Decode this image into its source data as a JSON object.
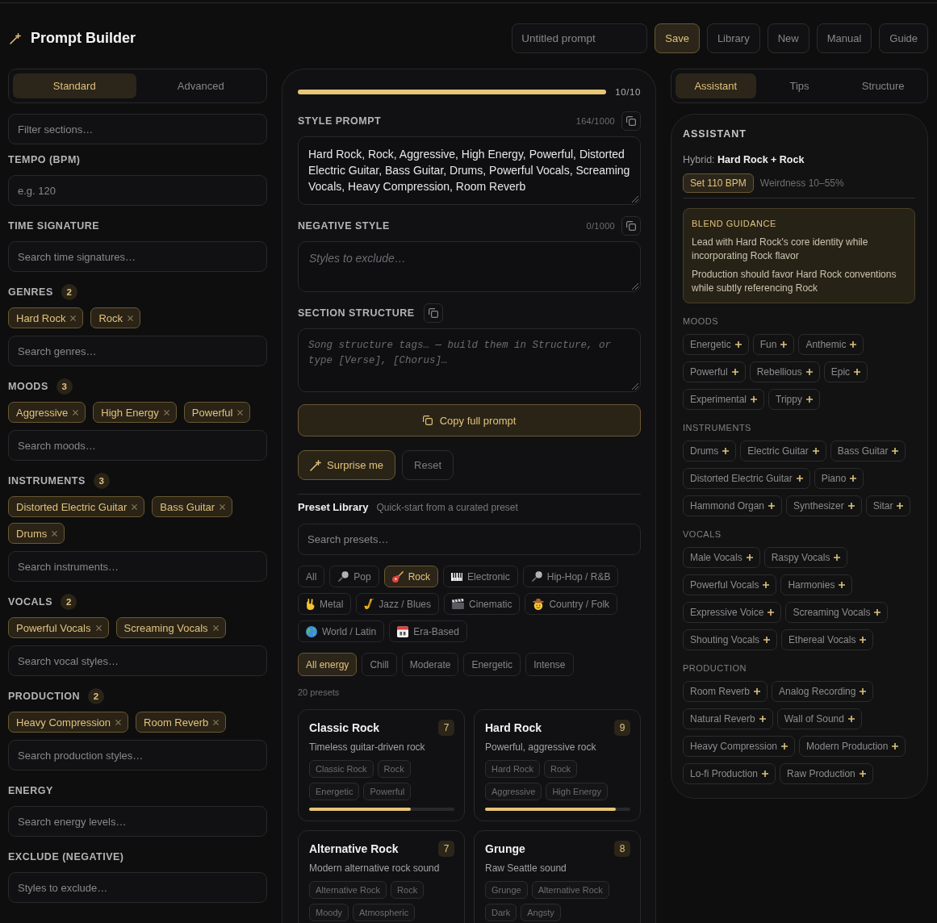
{
  "header": {
    "title": "Prompt Builder",
    "name_field": {
      "placeholder": "Untitled prompt"
    },
    "buttons": [
      {
        "label": "Save",
        "kind": "primary"
      },
      {
        "label": "Library",
        "kind": "plain"
      },
      {
        "label": "New",
        "kind": "plain"
      },
      {
        "label": "Manual",
        "kind": "plain"
      },
      {
        "label": "Guide",
        "kind": "plain"
      }
    ]
  },
  "sidebar": {
    "mode_tabs": [
      {
        "label": "Standard",
        "selected": true
      },
      {
        "label": "Advanced",
        "selected": false
      }
    ],
    "filter": {
      "placeholder": "Filter sections…"
    },
    "sections": [
      {
        "title": "TEMPO (BPM)",
        "field": {
          "placeholder": "e.g. 120"
        }
      },
      {
        "title": "TIME SIGNATURE",
        "field": {
          "placeholder": "Search time signatures…"
        }
      },
      {
        "title": "GENRES",
        "count": "2",
        "chips": [
          "Hard Rock",
          "Rock"
        ],
        "field": {
          "placeholder": "Search genres…"
        }
      },
      {
        "title": "MOODS",
        "count": "3",
        "chips": [
          "Aggressive",
          "High Energy",
          "Powerful"
        ],
        "field": {
          "placeholder": "Search moods…"
        }
      },
      {
        "title": "INSTRUMENTS",
        "count": "3",
        "chips": [
          "Distorted Electric Guitar",
          "Bass Guitar",
          "Drums"
        ],
        "field": {
          "placeholder": "Search instruments…"
        }
      },
      {
        "title": "VOCALS",
        "count": "2",
        "chips": [
          "Powerful Vocals",
          "Screaming Vocals"
        ],
        "field": {
          "placeholder": "Search vocal styles…"
        }
      },
      {
        "title": "PRODUCTION",
        "count": "2",
        "chips": [
          "Heavy Compression",
          "Room Reverb"
        ],
        "field": {
          "placeholder": "Search production styles…"
        }
      },
      {
        "title": "ENERGY",
        "field": {
          "placeholder": "Search energy levels…"
        }
      },
      {
        "title": "EXCLUDE (NEGATIVE)",
        "field": {
          "placeholder": "Styles to exclude…"
        }
      }
    ]
  },
  "builder": {
    "progress": {
      "level": 1,
      "reading": "10/10"
    },
    "fields": [
      {
        "kind": "prompt",
        "label": "STYLE PROMPT",
        "count": "164/1000",
        "value": "Hard Rock, Rock, Aggressive, High Energy, Powerful, Distorted Electric Guitar, Bass Guitar, Drums, Powerful Vocals, Screaming Vocals, Heavy Compression, Room Reverb"
      },
      {
        "kind": "negative",
        "label": "NEGATIVE STYLE",
        "count": "0/1000",
        "placeholder": "Styles to exclude…"
      },
      {
        "kind": "structure",
        "label": "SECTION STRUCTURE",
        "placeholder": "Song structure tags… — build them in Structure, or type [Verse], [Chorus]…"
      }
    ],
    "copy_button": "Copy full prompt",
    "actions": [
      {
        "label": "Surprise me",
        "kind": "primary"
      },
      {
        "label": "Reset",
        "kind": "plain"
      }
    ],
    "presets": {
      "title": "Preset Library",
      "subtitle": "Quick-start from a curated preset",
      "search": {
        "placeholder": "Search presets…"
      },
      "categories": [
        {
          "label": "All",
          "selected": false
        },
        {
          "label": "Pop",
          "selected": false
        },
        {
          "label": "Rock",
          "selected": true
        },
        {
          "label": "Electronic",
          "selected": false
        },
        {
          "label": "Hip-Hop / R&B",
          "selected": false
        },
        {
          "label": "Metal",
          "selected": false
        },
        {
          "label": "Jazz / Blues",
          "selected": false
        },
        {
          "label": "Cinematic",
          "selected": false
        },
        {
          "label": "Country / Folk",
          "selected": false
        },
        {
          "label": "World / Latin",
          "selected": false
        },
        {
          "label": "Era-Based",
          "selected": false
        }
      ],
      "energy": [
        {
          "label": "All energy",
          "selected": true
        },
        {
          "label": "Chill",
          "selected": false
        },
        {
          "label": "Moderate",
          "selected": false
        },
        {
          "label": "Energetic",
          "selected": false
        },
        {
          "label": "Intense",
          "selected": false
        }
      ],
      "count": "20 presets",
      "cards": [
        {
          "name": "Classic Rock",
          "score": "7",
          "description": "Timeless guitar-driven rock",
          "tags": [
            "Classic Rock",
            "Rock",
            "Energetic",
            "Powerful"
          ],
          "level": 0.7
        },
        {
          "name": "Hard Rock",
          "score": "9",
          "description": "Powerful, aggressive rock",
          "tags": [
            "Hard Rock",
            "Rock",
            "Aggressive",
            "High Energy"
          ],
          "level": 0.9
        },
        {
          "name": "Alternative Rock",
          "score": "7",
          "description": "Modern alternative rock sound",
          "tags": [
            "Alternative Rock",
            "Rock",
            "Moody",
            "Atmospheric"
          ]
        },
        {
          "name": "Grunge",
          "score": "8",
          "description": "Raw Seattle sound",
          "tags": [
            "Grunge",
            "Alternative Rock",
            "Dark",
            "Angsty"
          ]
        }
      ]
    }
  },
  "assistant_tabs": [
    {
      "label": "Assistant",
      "selected": true
    },
    {
      "label": "Tips",
      "selected": false
    },
    {
      "label": "Structure",
      "selected": false
    }
  ],
  "assistant": {
    "title": "ASSISTANT",
    "hybrid": "Hybrid: **Hard Rock + Rock**",
    "bpm_button": "Set 110 BPM",
    "weirdness": "Weirdness 10–55%",
    "guidance": {
      "title": "BLEND GUIDANCE",
      "paragraphs": [
        "Lead with Hard Rock's core identity while incorporating Rock flavor",
        "Production should favor Hard Rock conventions while subtly referencing Rock"
      ]
    },
    "groups": [
      {
        "title": "MOODS",
        "suggestions": [
          "Energetic",
          "Fun",
          "Anthemic",
          "Powerful",
          "Rebellious",
          "Epic",
          "Experimental",
          "Trippy"
        ]
      },
      {
        "title": "INSTRUMENTS",
        "suggestions": [
          "Drums",
          "Electric Guitar",
          "Bass Guitar",
          "Distorted Electric Guitar",
          "Piano",
          "Hammond Organ",
          "Synthesizer",
          "Sitar"
        ]
      },
      {
        "title": "VOCALS",
        "suggestions": [
          "Male Vocals",
          "Raspy Vocals",
          "Powerful Vocals",
          "Harmonies",
          "Expressive Voice",
          "Screaming Vocals",
          "Shouting Vocals",
          "Ethereal Vocals"
        ]
      },
      {
        "title": "PRODUCTION",
        "suggestions": [
          "Room Reverb",
          "Analog Recording",
          "Natural Reverb",
          "Wall of Sound",
          "Heavy Compression",
          "Modern Production",
          "Lo-fi Production",
          "Raw Production"
        ]
      }
    ]
  }
}
